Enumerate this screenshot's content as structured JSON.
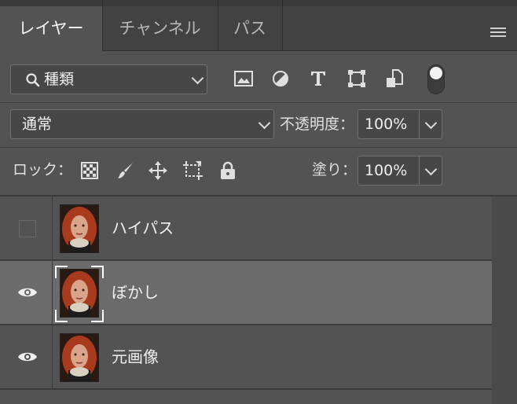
{
  "tabs": [
    {
      "label": "レイヤー",
      "active": true
    },
    {
      "label": "チャンネル",
      "active": false
    },
    {
      "label": "パス",
      "active": false
    }
  ],
  "filter": {
    "selected": "種類"
  },
  "filter_icons": [
    "image-filter-icon",
    "adjustment-filter-icon",
    "type-filter-icon",
    "shape-filter-icon",
    "smart-object-filter-icon",
    "filter-toggle-switch"
  ],
  "blend": {
    "mode": "通常",
    "opacity_label": "不透明度：",
    "opacity_value": "100%"
  },
  "lock": {
    "label": "ロック：",
    "fill_label": "塗り：",
    "fill_value": "100%"
  },
  "layers": [
    {
      "name": "ハイパス",
      "visible": false,
      "selected": false
    },
    {
      "name": "ぼかし",
      "visible": true,
      "selected": true
    },
    {
      "name": "元画像",
      "visible": true,
      "selected": false
    }
  ],
  "colors": {
    "panel": "#535353",
    "selected_row": "#6b6b6b",
    "tab_bar": "#424242"
  }
}
